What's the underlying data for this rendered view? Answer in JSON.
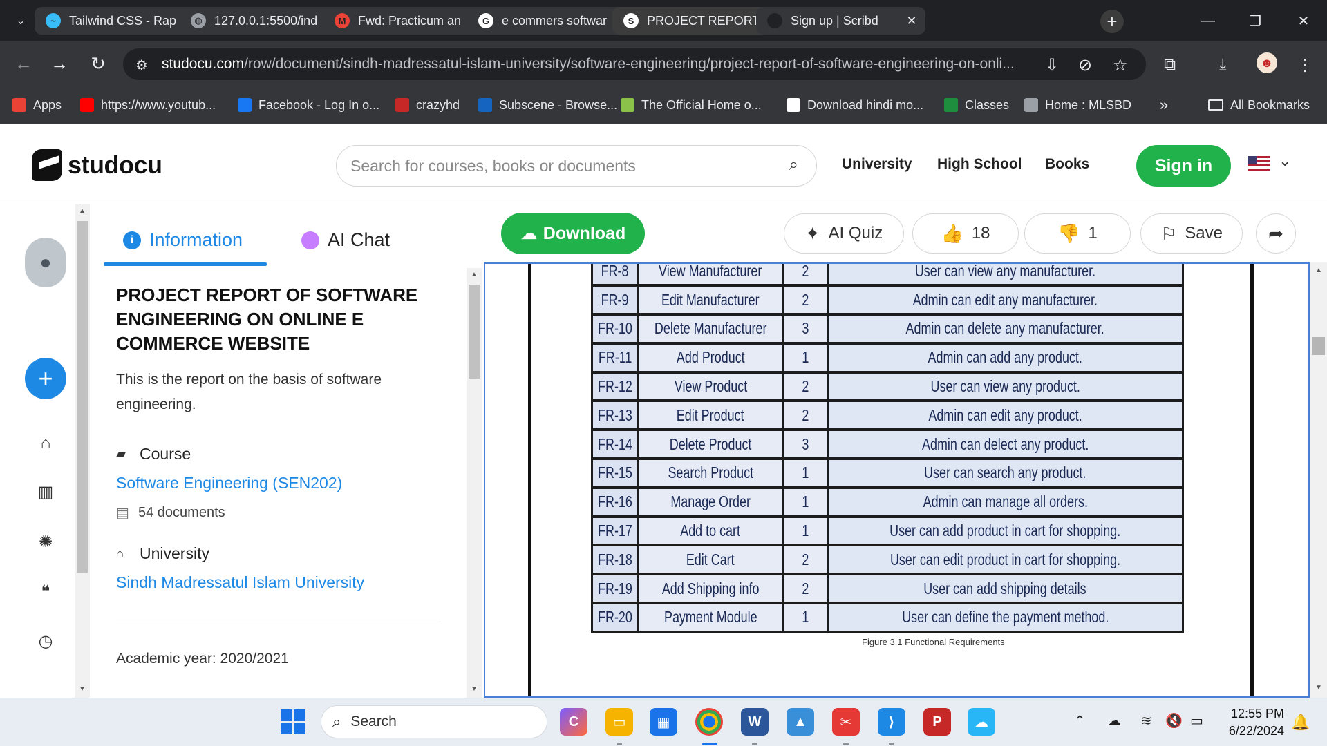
{
  "browser": {
    "tabs": [
      {
        "title": "Tailwind CSS - Rap",
        "icon": "tailwind-icon",
        "color": "#38bdf8",
        "glyph": "~"
      },
      {
        "title": "127.0.0.1:5500/ind",
        "icon": "globe-icon",
        "color": "#9aa0a6",
        "glyph": "◍"
      },
      {
        "title": "Fwd: Practicum an",
        "icon": "gmail-icon",
        "color": "#ea4335",
        "glyph": "M"
      },
      {
        "title": "e commers softwar",
        "icon": "google-icon",
        "color": "#ffffff",
        "glyph": "G"
      },
      {
        "title": "PROJECT REPORT (",
        "icon": "studocu-icon",
        "color": "#ffffff",
        "glyph": "S"
      },
      {
        "title": "Sign up | Scribd",
        "icon": "scribd-icon",
        "color": "#202124",
        "glyph": ""
      }
    ],
    "active_tab_index": 4,
    "url_host": "studocu.com",
    "url_path": "/row/document/sindh-madressatul-islam-university/software-engineering/project-report-of-software-engineering-on-onli...",
    "bookmarks": [
      {
        "label": "Apps",
        "icon": "apps-grid-icon",
        "color": "#ea4335"
      },
      {
        "label": "https://www.youtub...",
        "icon": "youtube-icon",
        "color": "#ff0000"
      },
      {
        "label": "Facebook - Log In o...",
        "icon": "facebook-icon",
        "color": "#1877f2"
      },
      {
        "label": "crazyhd",
        "icon": "crazyhd-icon",
        "color": "#c62828"
      },
      {
        "label": "Subscene - Browse...",
        "icon": "subscene-icon",
        "color": "#1565c0"
      },
      {
        "label": "The Official Home o...",
        "icon": "official-home-icon",
        "color": "#8bc34a"
      },
      {
        "label": "Download hindi mo...",
        "icon": "page-icon",
        "color": "#ffffff"
      },
      {
        "label": "Classes",
        "icon": "classroom-icon",
        "color": "#1e8e3e"
      },
      {
        "label": "Home : MLSBD",
        "icon": "globe-icon",
        "color": "#9aa0a6"
      }
    ],
    "all_bookmarks": "All Bookmarks"
  },
  "site": {
    "logo_text": "studocu",
    "search_placeholder": "Search for courses, books or documents",
    "nav": [
      "University",
      "High School",
      "Books"
    ],
    "signin": "Sign in",
    "accent_green": "#22b24c",
    "accent_blue": "#1e88e5"
  },
  "info": {
    "tab_information": "Information",
    "tab_ai_chat": "AI Chat",
    "title": "PROJECT REPORT OF SOFTWARE ENGINEERING ON ONLINE E COMMERCE WEBSITE",
    "description": "This is the report on the basis of software engineering.",
    "course_label": "Course",
    "course_name": "Software Engineering (SEN202)",
    "documents": "54 documents",
    "university_label": "University",
    "university_name": "Sindh Madressatul Islam University",
    "academic_year": "Academic year: 2020/2021"
  },
  "actions": {
    "download": "Download",
    "ai_quiz": "AI Quiz",
    "likes": "18",
    "dislikes": "1",
    "save": "Save"
  },
  "document": {
    "rows": [
      {
        "id": "FR-8",
        "name": "View Manufacturer",
        "priority": "2",
        "desc": "User can view any manufacturer."
      },
      {
        "id": "FR-9",
        "name": "Edit Manufacturer",
        "priority": "2",
        "desc": "Admin can edit any manufacturer."
      },
      {
        "id": "FR-10",
        "name": "Delete Manufacturer",
        "priority": "3",
        "desc": "Admin can delete any manufacturer."
      },
      {
        "id": "FR-11",
        "name": "Add Product",
        "priority": "1",
        "desc": "Admin can add any product."
      },
      {
        "id": "FR-12",
        "name": "View Product",
        "priority": "2",
        "desc": "User can view any product."
      },
      {
        "id": "FR-13",
        "name": "Edit Product",
        "priority": "2",
        "desc": "Admin can edit any product."
      },
      {
        "id": "FR-14",
        "name": "Delete Product",
        "priority": "3",
        "desc": "Admin can delect any product."
      },
      {
        "id": "FR-15",
        "name": "Search Product",
        "priority": "1",
        "desc": "User can search any product."
      },
      {
        "id": "FR-16",
        "name": "Manage Order",
        "priority": "1",
        "desc": "Admin can manage all orders."
      },
      {
        "id": "FR-17",
        "name": "Add to cart",
        "priority": "1",
        "desc": "User can add product in cart for shopping."
      },
      {
        "id": "FR-18",
        "name": "Edit Cart",
        "priority": "2",
        "desc": "User can edit product in cart for shopping."
      },
      {
        "id": "FR-19",
        "name": "Add Shipping info",
        "priority": "2",
        "desc": "User can add shipping details"
      },
      {
        "id": "FR-20",
        "name": "Payment Module",
        "priority": "1",
        "desc": "User can define the payment method."
      }
    ],
    "caption": "Figure 3.1 Functional Requirements"
  },
  "taskbar": {
    "search": "Search",
    "time": "12:55 PM",
    "date": "6/22/2024"
  }
}
